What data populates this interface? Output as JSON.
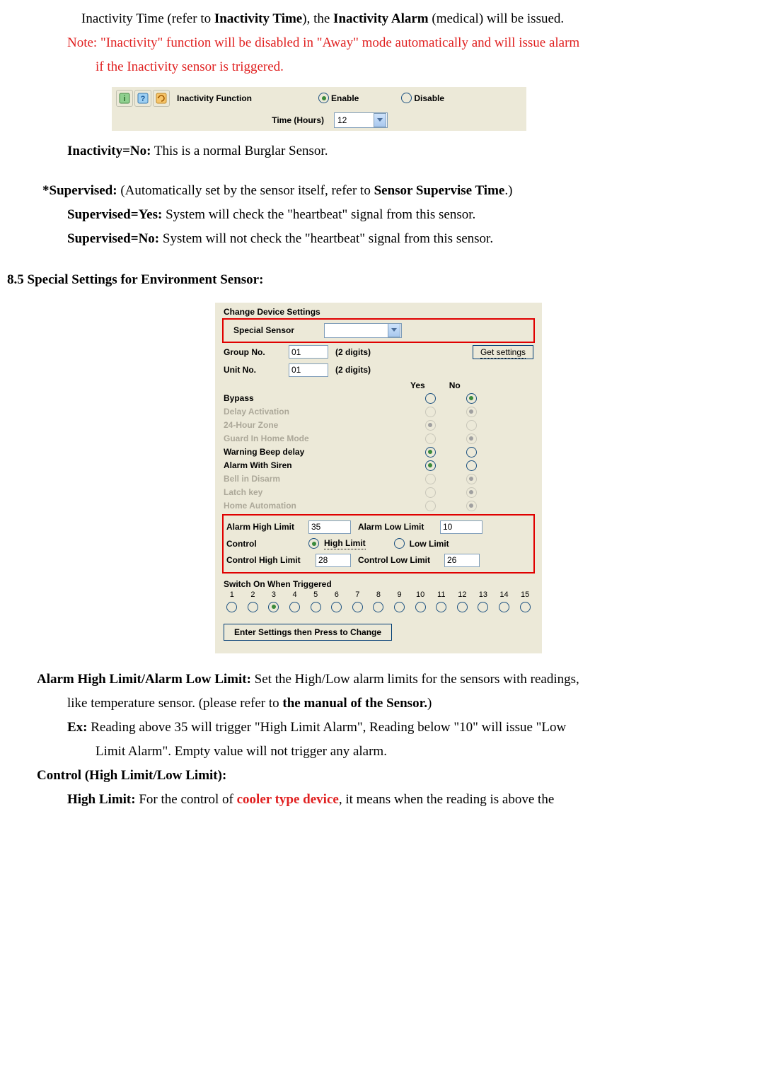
{
  "para": {
    "inactivity_time_line": "Inactivity Time (refer to ",
    "inactivity_time_bold": "Inactivity Time",
    "inactivity_time_line2": "), the ",
    "inactivity_alarm_bold": "Inactivity Alarm",
    "inactivity_time_line3": " (medical) will be issued.",
    "note_line": "Note: \"Inactivity\" function will be disabled in \"Away\" mode automatically and will issue alarm",
    "note_line2": "if the Inactivity sensor is triggered.",
    "inact_no_bold": "Inactivity=No:",
    "inact_no_rest": " This is a normal Burglar Sensor.",
    "supervised_lead": "*Supervised:",
    "supervised_rest": " (Automatically set by the sensor itself, refer to ",
    "supervised_rest_bold": "Sensor Supervise Time",
    "supervised_rest2": ".)",
    "sup_yes_bold": "Supervised=Yes:",
    "sup_yes_rest": " System will check the \"heartbeat\" signal from this sensor.",
    "sup_no_bold": "Supervised=No:",
    "sup_no_rest": " System will not check the \"heartbeat\" signal from this sensor.",
    "section_title": "8.5 Special Settings for Environment Sensor:",
    "ahl_bold": "Alarm High Limit/Alarm Low Limit:",
    "ahl_rest": " Set the High/Low alarm limits for the sensors with readings,",
    "ahl_line2a": "like temperature sensor. (please refer to ",
    "ahl_line2b": "the manual of the Sensor.",
    "ahl_line2c": ")",
    "ex_bold": "Ex:",
    "ex_rest": " Reading above 35 will trigger \"High Limit Alarm\", Reading below \"10\" will issue \"Low",
    "ex_line2": "Limit Alarm\". Empty value will not trigger any alarm.",
    "control_bold": "Control (High Limit/Low Limit):",
    "hl_bold": "High Limit:",
    "hl_rest1": " For the control of ",
    "hl_red": "cooler type device",
    "hl_rest2": ", it means when the reading is above the"
  },
  "fig1": {
    "inact_func_label": "Inactivity Function",
    "time_hours_label": "Time (Hours)",
    "enable": "Enable",
    "disable": "Disable",
    "time_value": "12"
  },
  "fig2": {
    "title": "Change Device Settings",
    "special_sensor_label": "Special Sensor",
    "special_sensor_value": "",
    "group_no_label": "Group No.",
    "group_no_value": "01",
    "unit_no_label": "Unit No.",
    "unit_no_value": "01",
    "two_digits": "(2 digits)",
    "get_settings_btn": "Get settings",
    "yes": "Yes",
    "no": "No",
    "options": [
      {
        "label": "Bypass",
        "enabled": true,
        "sel": "no"
      },
      {
        "label": "Delay Activation",
        "enabled": false,
        "sel": "no"
      },
      {
        "label": "24-Hour Zone",
        "enabled": false,
        "sel": "yes"
      },
      {
        "label": "Guard In Home Mode",
        "enabled": false,
        "sel": "no"
      },
      {
        "label": "Warning Beep delay",
        "enabled": true,
        "sel": "yes"
      },
      {
        "label": "Alarm With Siren",
        "enabled": true,
        "sel": "yes"
      },
      {
        "label": "Bell in Disarm",
        "enabled": false,
        "sel": "no"
      },
      {
        "label": "Latch key",
        "enabled": false,
        "sel": "no"
      },
      {
        "label": "Home Automation",
        "enabled": false,
        "sel": "no"
      }
    ],
    "alarm_high_label": "Alarm High Limit",
    "alarm_high_value": "35",
    "alarm_low_label": "Alarm Low Limit",
    "alarm_low_value": "10",
    "control_label": "Control",
    "high_limit_opt": "High Limit",
    "low_limit_opt": "Low Limit",
    "ctrl_high_label": "Control High Limit",
    "ctrl_high_value": "28",
    "ctrl_low_label": "Control Low Limit",
    "ctrl_low_value": "26",
    "switch_title": "Switch On When Triggered",
    "switches": [
      "1",
      "2",
      "3",
      "4",
      "5",
      "6",
      "7",
      "8",
      "9",
      "10",
      "11",
      "12",
      "13",
      "14",
      "15"
    ],
    "switch_selected_index": 2,
    "submit_btn": "Enter Settings then Press to Change"
  }
}
